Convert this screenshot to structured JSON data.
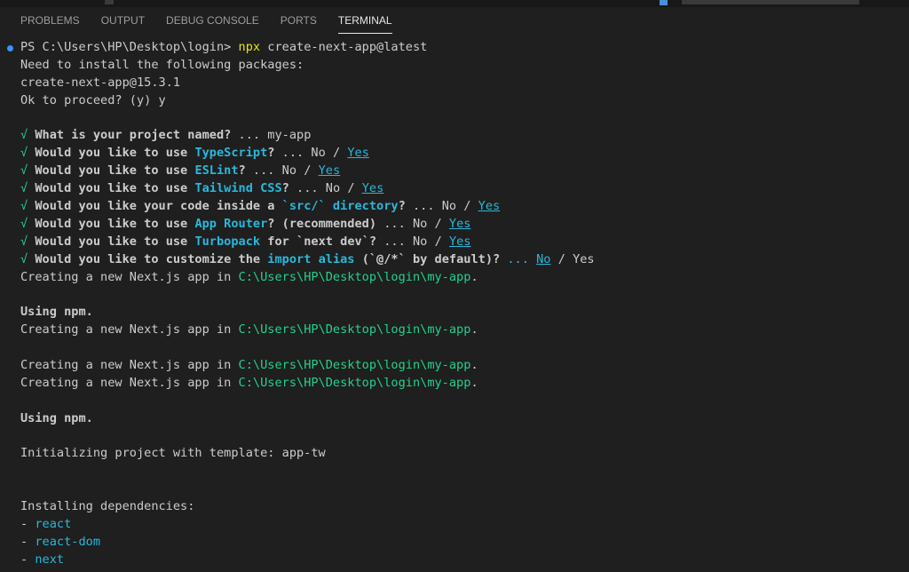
{
  "panel": {
    "tabs": [
      "PROBLEMS",
      "OUTPUT",
      "DEBUG CONSOLE",
      "PORTS",
      "TERMINAL"
    ],
    "active_tab": "TERMINAL"
  },
  "terminal": {
    "prompt": "PS C:\\Users\\HP\\Desktop\\login>",
    "cmd_name": "npx",
    "cmd_args": "create-next-app@latest",
    "install_header": "Need to install the following packages:",
    "package": "create-next-app@15.3.1",
    "proceed_q": "Ok to proceed? (y)",
    "proceed_a": "y",
    "check": "√",
    "q_name_text": "What is your project named?",
    "q_name_dots": "...",
    "q_name_answer": "my-app",
    "would_use": "Would you like to use",
    "ts_tool": "TypeScript",
    "eslint_tool": "ESLint",
    "tw_tool": "Tailwind CSS",
    "src_pre": "Would you like your code inside a",
    "src_tool": "`src/` directory",
    "ar_tool": "App Router",
    "ar_suffix": "? (recommended)",
    "tp_tool": "Turbopack",
    "tp_mid": "for `next dev`?",
    "alias_pre": "Would you like to customize the",
    "alias_tool": "import alias",
    "alias_post": "(`@/*` by default)?",
    "qmark": "?",
    "dots": "...",
    "no": "No",
    "slash": "/",
    "yes": "Yes",
    "creating_text": "Creating a new Next.js app in",
    "app_path": "C:\\Users\\HP\\Desktop\\login\\my-app",
    "period": ".",
    "using_npm": "Using npm.",
    "init_text": "Initializing project with template: app-tw",
    "deps_header": "Installing dependencies:",
    "dash": "-",
    "deps": [
      "react",
      "react-dom",
      "next"
    ]
  }
}
